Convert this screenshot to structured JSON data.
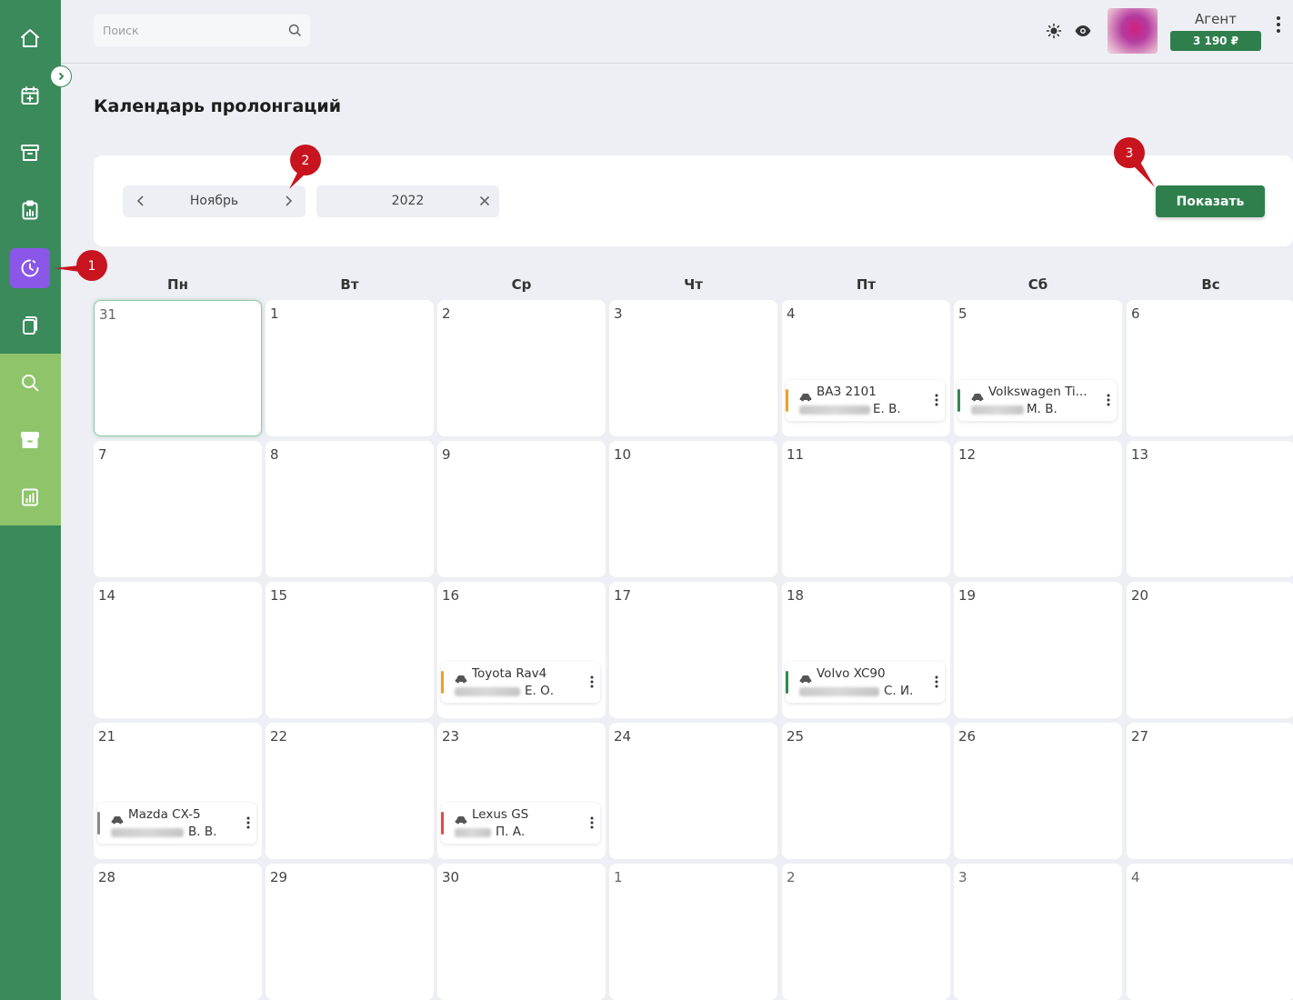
{
  "header": {
    "search_placeholder": "Поиск",
    "agent_label": "Агент",
    "balance": "3 190 ₽"
  },
  "page": {
    "title": "Календарь пролонгаций"
  },
  "filters": {
    "month": "Ноябрь",
    "year": "2022",
    "show_button": "Показать"
  },
  "calendar": {
    "weekdays": [
      "Пн",
      "Вт",
      "Ср",
      "Чт",
      "Пт",
      "Сб",
      "Вс"
    ],
    "weeks": [
      [
        "31",
        "1",
        "2",
        "3",
        "4",
        "5",
        "6"
      ],
      [
        "7",
        "8",
        "9",
        "10",
        "11",
        "12",
        "13"
      ],
      [
        "14",
        "15",
        "16",
        "17",
        "18",
        "19",
        "20"
      ],
      [
        "21",
        "22",
        "23",
        "24",
        "25",
        "26",
        "27"
      ],
      [
        "28",
        "29",
        "30",
        "1",
        "2",
        "3",
        "4"
      ]
    ],
    "events": [
      {
        "model": "ВАЗ 2101",
        "initials": "Е. В.",
        "color": "#f0a020"
      },
      {
        "model": "Volkswagen Ti...",
        "initials": "М. В.",
        "color": "#2f8a50"
      },
      {
        "model": "Toyota Rav4",
        "initials": "Е. О.",
        "color": "#f0a020"
      },
      {
        "model": "Volvo XC90",
        "initials": "С. И.",
        "color": "#2f8a50"
      },
      {
        "model": "Mazda CX-5",
        "initials": "В. В.",
        "color": "#888888"
      },
      {
        "model": "Lexus GS",
        "initials": "П. А.",
        "color": "#e04a4a"
      }
    ]
  },
  "annotations": [
    "1",
    "2",
    "3"
  ],
  "colors": {
    "sidebar": "#3a8a5c",
    "sidebar_light": "#8fc46b",
    "active_item": "#8b57e8",
    "primary_button": "#2f7f4d",
    "marker": "#c8141e"
  }
}
